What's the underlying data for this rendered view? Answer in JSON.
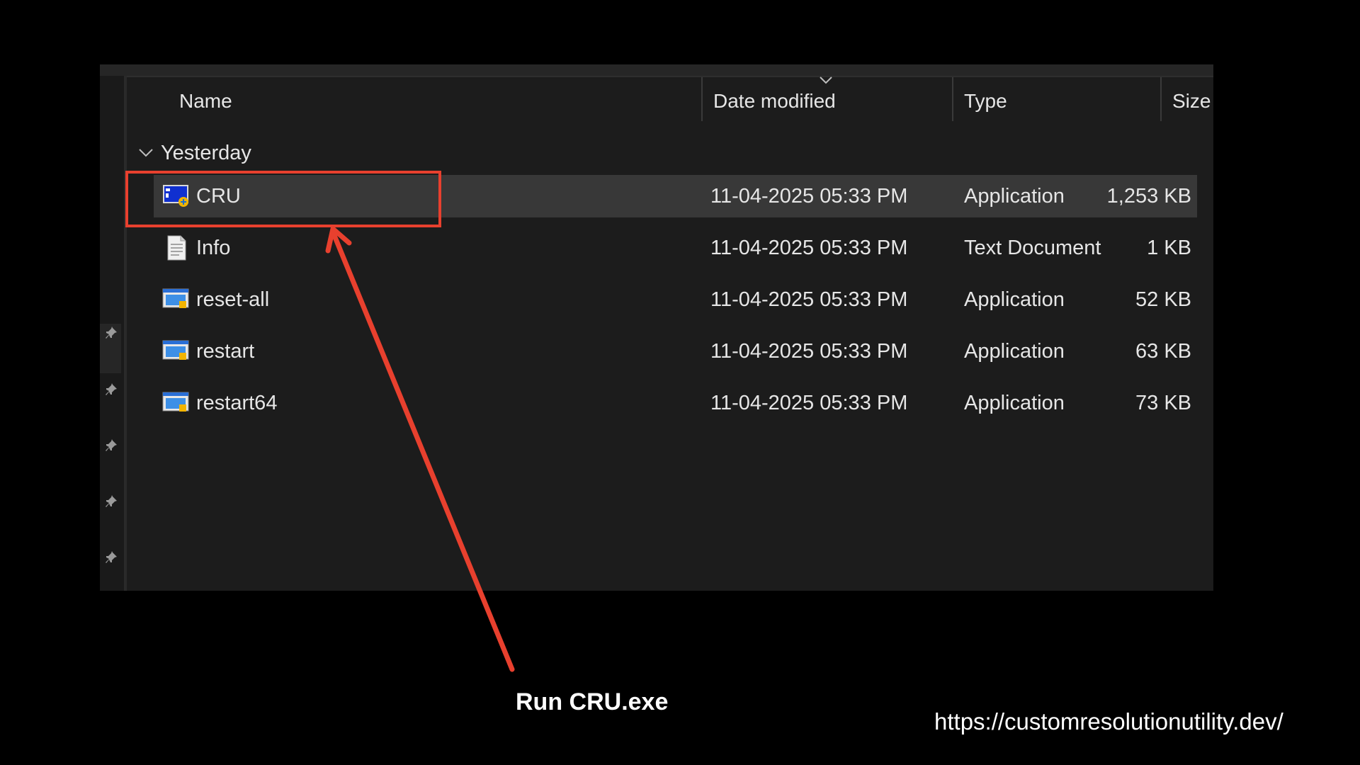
{
  "columns": {
    "name": "Name",
    "date_modified": "Date modified",
    "type": "Type",
    "size": "Size"
  },
  "group": {
    "label": "Yesterday"
  },
  "files": [
    {
      "name": "CRU",
      "date": "11-04-2025 05:33 PM",
      "type": "Application",
      "size": "1,253 KB",
      "icon": "cru-app-icon",
      "selected": true
    },
    {
      "name": "Info",
      "date": "11-04-2025 05:33 PM",
      "type": "Text Document",
      "size": "1 KB",
      "icon": "text-document-icon",
      "selected": false
    },
    {
      "name": "reset-all",
      "date": "11-04-2025 05:33 PM",
      "type": "Application",
      "size": "52 KB",
      "icon": "application-icon",
      "selected": false
    },
    {
      "name": "restart",
      "date": "11-04-2025 05:33 PM",
      "type": "Application",
      "size": "63 KB",
      "icon": "application-icon",
      "selected": false
    },
    {
      "name": "restart64",
      "date": "11-04-2025 05:33 PM",
      "type": "Application",
      "size": "73 KB",
      "icon": "application-icon",
      "selected": false
    }
  ],
  "annotation": {
    "caption": "Run CRU.exe",
    "url": "https://customresolutionutility.dev/",
    "accent_color": "#e8402e"
  },
  "colors": {
    "background": "#000000",
    "explorer_bg": "#1c1c1c",
    "selected_row": "#383838"
  }
}
